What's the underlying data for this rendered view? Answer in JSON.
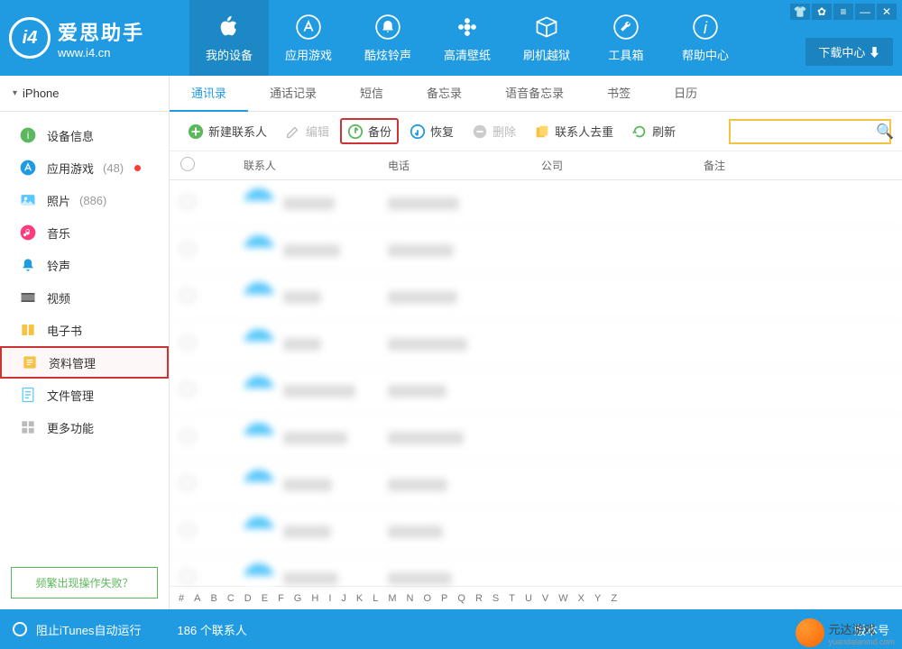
{
  "app": {
    "name": "爱思助手",
    "url": "www.i4.cn",
    "download_center": "下载中心"
  },
  "top_nav": [
    {
      "label": "我的设备"
    },
    {
      "label": "应用游戏"
    },
    {
      "label": "酷炫铃声"
    },
    {
      "label": "高清壁纸"
    },
    {
      "label": "刷机越狱"
    },
    {
      "label": "工具箱"
    },
    {
      "label": "帮助中心"
    }
  ],
  "sidebar": {
    "device": "iPhone",
    "items": [
      {
        "label": "设备信息"
      },
      {
        "label": "应用游戏",
        "count": "(48)",
        "dot": true
      },
      {
        "label": "照片",
        "count": "(886)"
      },
      {
        "label": "音乐"
      },
      {
        "label": "铃声"
      },
      {
        "label": "视频"
      },
      {
        "label": "电子书"
      },
      {
        "label": "资料管理"
      },
      {
        "label": "文件管理"
      },
      {
        "label": "更多功能"
      }
    ],
    "fail_link": "频繁出现操作失败？"
  },
  "tabs": [
    {
      "label": "通讯录"
    },
    {
      "label": "通话记录"
    },
    {
      "label": "短信"
    },
    {
      "label": "备忘录"
    },
    {
      "label": "语音备忘录"
    },
    {
      "label": "书签"
    },
    {
      "label": "日历"
    }
  ],
  "toolbar": {
    "new": "新建联系人",
    "edit": "编辑",
    "backup": "备份",
    "restore": "恢复",
    "delete": "删除",
    "dedup": "联系人去重",
    "refresh": "刷新"
  },
  "columns": {
    "contact": "联系人",
    "phone": "电话",
    "company": "公司",
    "remark": "备注"
  },
  "alpha": [
    "#",
    "A",
    "B",
    "C",
    "D",
    "E",
    "F",
    "G",
    "H",
    "I",
    "J",
    "K",
    "L",
    "M",
    "N",
    "O",
    "P",
    "Q",
    "R",
    "S",
    "T",
    "U",
    "V",
    "W",
    "X",
    "Y",
    "Z"
  ],
  "status": {
    "itunes": "阻止iTunes自动运行",
    "count": "186 个联系人",
    "version": "版本号"
  },
  "watermark": {
    "text": "元达游戏",
    "sub": "yuandalanmd.com"
  }
}
